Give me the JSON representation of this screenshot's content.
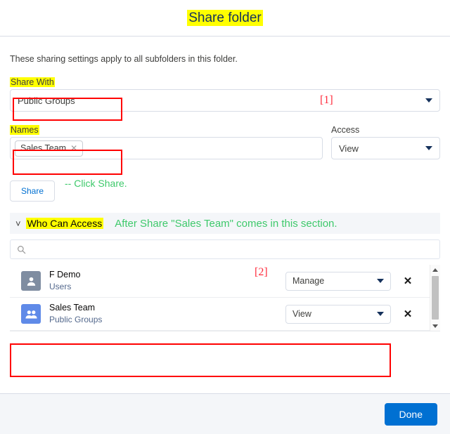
{
  "dialog": {
    "title": "Share folder",
    "intro": "These sharing settings apply to all subfolders in this folder."
  },
  "annotations": {
    "step_one": "[1]",
    "step_two": "[2]",
    "share_note": "-- Click Share.",
    "access_note": "After Share \"Sales Team\" comes in this section."
  },
  "share_with": {
    "label": "Share With",
    "value": "Public Groups",
    "caret_icon": "chevron-down-icon"
  },
  "names": {
    "label": "Names",
    "token": "Sales Team",
    "token_remove_icon": "close-icon",
    "placeholder": ""
  },
  "access": {
    "label": "Access",
    "value": "View",
    "caret_icon": "chevron-down-icon"
  },
  "share_button": {
    "label": "Share"
  },
  "who_can_access": {
    "label": "Who Can Access",
    "chevron_icon": "chevron-down-icon",
    "search": {
      "placeholder": "",
      "value": "",
      "icon": "search-icon"
    },
    "rows": [
      {
        "name": "F Demo",
        "type": "Users",
        "avatar_icon": "person-icon",
        "avatar_color": "#7f8da1",
        "access": "Manage",
        "remove_icon": "close-icon"
      },
      {
        "name": "Sales Team",
        "type": "Public Groups",
        "avatar_icon": "group-icon",
        "avatar_color": "#5f8ae8",
        "access": "View",
        "remove_icon": "close-icon"
      }
    ],
    "scrollbar": {
      "up_icon": "caret-up-icon",
      "down_icon": "caret-down-icon"
    }
  },
  "footer": {
    "done_label": "Done"
  },
  "colors": {
    "highlight": "#ffff00",
    "annotation_red": "#ff0000",
    "annotation_green": "#3ec96b",
    "primary_blue": "#0070d2",
    "title_navy": "#16325c"
  }
}
